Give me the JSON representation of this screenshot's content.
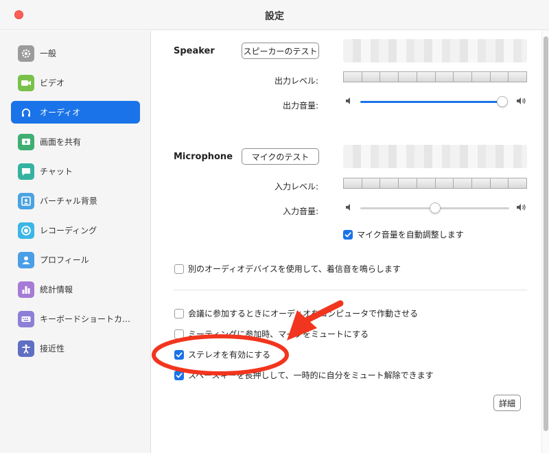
{
  "window": {
    "title": "設定"
  },
  "sidebar": {
    "items": [
      {
        "label": "一般",
        "icon": "gear-icon",
        "color": "#9b9b9b"
      },
      {
        "label": "ビデオ",
        "icon": "video-camera-icon",
        "color": "#79c14b"
      },
      {
        "label": "オーディオ",
        "icon": "headphones-icon",
        "color": "#1a73e8",
        "active": true
      },
      {
        "label": "画面を共有",
        "icon": "share-screen-icon",
        "color": "#3fae73"
      },
      {
        "label": "チャット",
        "icon": "chat-bubble-icon",
        "color": "#35b3a0"
      },
      {
        "label": "バーチャル背景",
        "icon": "virtual-background-icon",
        "color": "#4aa3e0"
      },
      {
        "label": "レコーディング",
        "icon": "record-icon",
        "color": "#3db6e6"
      },
      {
        "label": "プロフィール",
        "icon": "profile-icon",
        "color": "#4a9ee6"
      },
      {
        "label": "統計情報",
        "icon": "statistics-icon",
        "color": "#a57bd6"
      },
      {
        "label": "キーボードショートカ…",
        "icon": "keyboard-icon",
        "color": "#8e7fd6"
      },
      {
        "label": "接近性",
        "icon": "accessibility-icon",
        "color": "#5f6fc2"
      }
    ]
  },
  "speaker": {
    "label": "Speaker",
    "test_button": "スピーカーのテスト",
    "output_level_label": "出力レベル:",
    "output_volume_label": "出力音量:",
    "volume_fraction": 0.97
  },
  "microphone": {
    "label": "Microphone",
    "test_button": "マイクのテスト",
    "input_level_label": "入力レベル:",
    "input_volume_label": "入力音量:",
    "volume_fraction": 0.5,
    "auto_adjust": {
      "label": "マイク音量を自動調整します",
      "checked": true
    }
  },
  "ringtone": {
    "label": "別のオーディオデバイスを使用して、着信音を鳴らします",
    "checked": false
  },
  "options": [
    {
      "label": "会議に参加するときにオーディオをコンピュータで作動させる",
      "checked": false
    },
    {
      "label": "ミーティングに参加時、マイクをミュートにする",
      "checked": false
    },
    {
      "label": "ステレオを有効にする",
      "checked": true
    },
    {
      "label": "スペースキーを長押しして、一時的に自分をミュート解除できます",
      "checked": true
    }
  ],
  "advanced_button": "詳細",
  "colors": {
    "accent": "#1a73e8",
    "annotation": "#f2351e"
  }
}
